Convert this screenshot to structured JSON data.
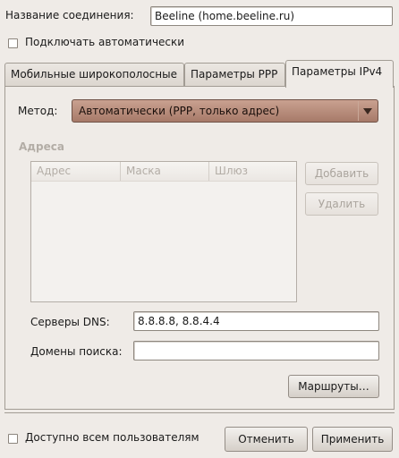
{
  "connection_name": {
    "label": "Название соединения:",
    "value": "Beeline (home.beeline.ru)"
  },
  "auto_connect": {
    "label": "Подключать автоматически",
    "checked": false
  },
  "tabs": [
    {
      "label": "Мобильные широкополосные",
      "active": false
    },
    {
      "label": "Параметры PPP",
      "active": false
    },
    {
      "label": "Параметры IPv4",
      "active": true
    }
  ],
  "ipv4": {
    "method_label": "Метод:",
    "method_value": "Автоматически (PPP, только адрес)",
    "addresses_title": "Адреса",
    "columns": [
      "Адрес",
      "Маска",
      "Шлюз"
    ],
    "add_button": "Добавить",
    "delete_button": "Удалить",
    "dns_label": "Серверы DNS:",
    "dns_value": "8.8.8.8, 8.8.4.4",
    "search_domains_label": "Домены поиска:",
    "search_domains_value": "",
    "routes_button": "Маршруты…"
  },
  "footer": {
    "all_users_label": "Доступно всем пользователям",
    "all_users_checked": false,
    "cancel_button": "Отменить",
    "apply_button": "Применить"
  }
}
